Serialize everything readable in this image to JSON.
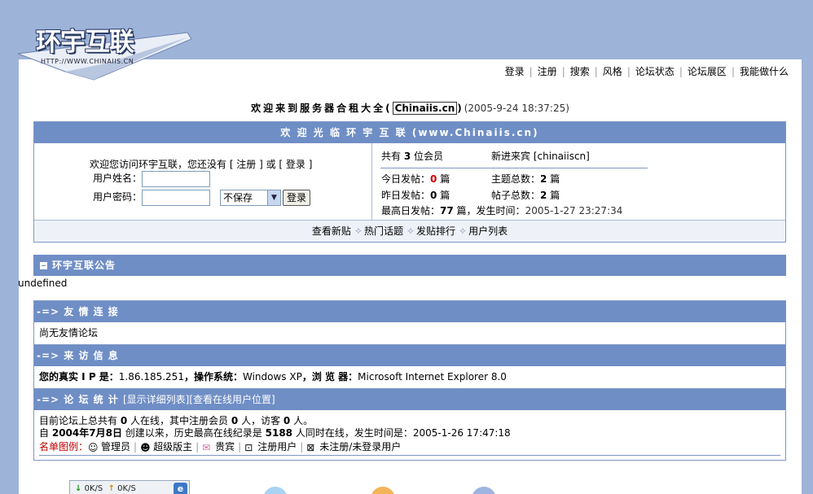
{
  "logo": {
    "title": "环宇互联",
    "url": "HTTP://WWW.CHINAIIS.CN"
  },
  "topnav": [
    "登录",
    "注册",
    "搜索",
    "风格",
    "论坛状态",
    "论坛展区",
    "我能做什么"
  ],
  "welcome": {
    "main": "欢迎来到服务器合租大全",
    "brand": "Chinaiis.cn",
    "time": "(2005-9-24 18:37:25)"
  },
  "login": {
    "title": "欢 迎 光 临 环 宇 互 联 (www.Chinaiis.cn)",
    "intro": "欢迎您访问环宇互联，您还没有 [ 注册 ] 或 [ 登录 ]",
    "username_label": "用户姓名：",
    "password_label": "用户密码：",
    "save_option": "不保存",
    "login_button": "登录",
    "footer": [
      "查看新贴",
      "热门话题",
      "发贴排行",
      "用户列表"
    ]
  },
  "stats_panel": {
    "members_label": "共有",
    "members_count": "3",
    "members_unit": "位会员",
    "newest_label": "新进来宾",
    "newest_user": "[chinaiiscn]",
    "today_label": "今日发帖：",
    "today_value": "0",
    "today_unit": "篇",
    "topics_label": "主题总数：",
    "topics_value": "2",
    "topics_unit": "篇",
    "yesterday_label": "昨日发帖：",
    "yesterday_value": "0",
    "yesterday_unit": "篇",
    "posts_label": "帖子总数：",
    "posts_value": "2",
    "posts_unit": "篇",
    "max_label": "最高日发帖：",
    "max_value": "77",
    "max_unit": "篇，发生时间：",
    "max_time": "2005-1-27 23:27:34"
  },
  "announcement": {
    "title": "环宇互联公告",
    "content": "undefined"
  },
  "friends": {
    "title": "-=> 友 情 连 接",
    "content": "尚无友情论坛"
  },
  "visitor": {
    "title": "-=> 来 访 信 息",
    "ip_label": "您的真实 I P  是：",
    "ip": "1.86.185.251",
    "os_label": "，操作系统：",
    "os": "Windows XP",
    "browser_label": "，浏 览 器：",
    "browser": "Microsoft Internet Explorer 8.0"
  },
  "forum_stats": {
    "title": "-=> 论 坛 统 计",
    "links": "[显示详细列表][查看在线用户位置]",
    "line1_a": "目前论坛上总共有",
    "online": "0",
    "line1_b": "人在线，其中注册会员",
    "registered": "0",
    "line1_c": "人，访客",
    "guests": "0",
    "line1_d": "人。",
    "line2_a": "自",
    "since": "2004年7月8日",
    "line2_b": "创建以来，历史最高在线纪录是",
    "record": "5188",
    "line2_c": "人同时在线，发生时间是：",
    "record_time": "2005-1-26 17:47:18",
    "legend_label": "名单图例：",
    "legend": [
      "管理员",
      "超级版主",
      "贵宾",
      "注册用户",
      "未注册/未登录用户"
    ]
  },
  "taskbar": {
    "down": "0K/S",
    "up": "0K/S"
  }
}
